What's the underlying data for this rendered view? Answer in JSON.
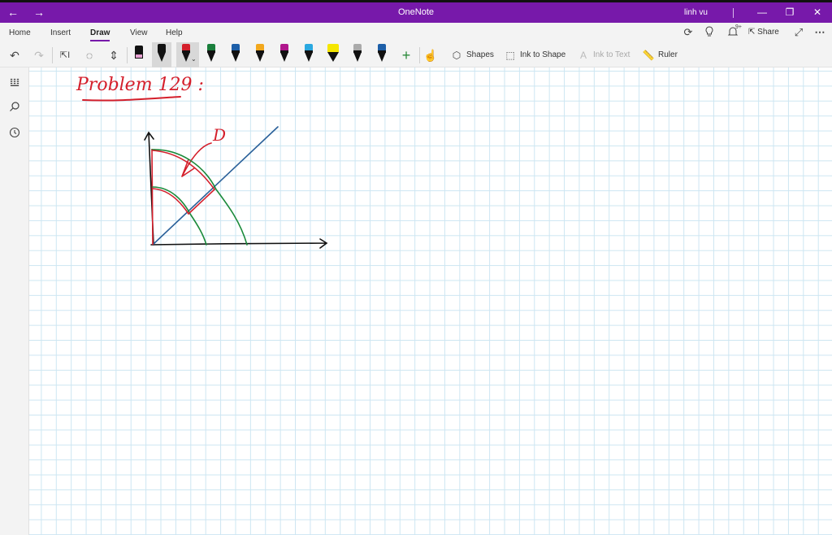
{
  "window": {
    "title": "OneNote",
    "user": "linh vu",
    "back_icon": "arrow-left-icon",
    "forward_icon": "arrow-right-icon",
    "minimize": "—",
    "maximize": "❐",
    "close": "✕"
  },
  "menu": {
    "items": [
      "Home",
      "Insert",
      "Draw",
      "View",
      "Help"
    ],
    "active": "Draw",
    "notification_count": "9+",
    "share_label": "Share",
    "more": "⋯"
  },
  "toolbar": {
    "shapes_label": "Shapes",
    "ink_to_shape_label": "Ink to Shape",
    "ink_to_text_label": "Ink to Text",
    "ruler_label": "Ruler",
    "pen_colors": [
      "#111111",
      "#111111",
      "#d41f2b",
      "#1a7f3c",
      "#1d5fa8",
      "#f2a81d",
      "#b0168c",
      "#2aa8e0",
      "#f5e600",
      "#1d3b78",
      "#1d5fa8"
    ]
  },
  "page": {
    "ink_title": "Problem 129 :",
    "ink_label": "D",
    "ink_colors": {
      "red": "#d41f2b",
      "blue": "#2a6099",
      "green": "#1a8a3a",
      "black": "#111111"
    }
  }
}
